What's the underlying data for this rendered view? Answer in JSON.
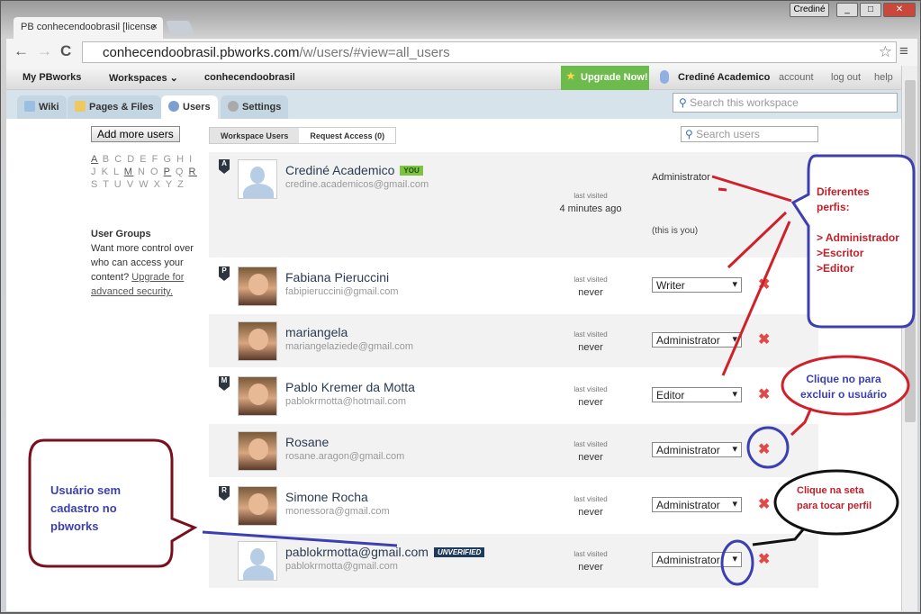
{
  "window": {
    "title_badge": "Crediné",
    "controls": [
      "_",
      "□",
      "✕"
    ]
  },
  "browser": {
    "tab_title": "PB conhecendoobrasil [license",
    "tab_close": "×",
    "url_host": "conhecendoobrasil.pbworks.com",
    "url_path": "/w/users/#view=all_users",
    "back": "←",
    "forward": "→",
    "reload": "C",
    "star": "☆",
    "menu": "≡"
  },
  "topbar": {
    "my_pbworks": "My PBworks",
    "workspaces": "Workspaces ⌄",
    "workspace": "conhecendoobrasil",
    "upgrade": "Upgrade Now!",
    "user": "Crediné Academico",
    "account": "account",
    "logout": "log out",
    "help": "help"
  },
  "tabs": [
    {
      "label": "Wiki"
    },
    {
      "label": "Pages & Files"
    },
    {
      "label": "Users",
      "active": true
    },
    {
      "label": "Settings"
    }
  ],
  "workspace_search_placeholder": "Search this workspace",
  "sidebar": {
    "add_users": "Add more users",
    "alpha_rows": [
      [
        "A",
        "B",
        "C",
        "D",
        "E",
        "F",
        "G",
        "H",
        "I"
      ],
      [
        "J",
        "K",
        "L",
        "M",
        "N",
        "O",
        "P",
        "Q",
        "R"
      ],
      [
        "S",
        "T",
        "U",
        "V",
        "W",
        "X",
        "Y",
        "Z"
      ]
    ],
    "alpha_active": [
      "A",
      "M",
      "P",
      "R"
    ],
    "groups_title": "User Groups",
    "groups_text": "Want more control over who can access your content?",
    "groups_link": "Upgrade for advanced security."
  },
  "segments": {
    "workspace_users": "Workspace Users",
    "request_access": "Request Access (0)"
  },
  "user_search_placeholder": "Search users",
  "users": [
    {
      "marker": "A",
      "name": "Crediné Academico",
      "badge": "YOU",
      "email": "credine.academicos@gmail.com",
      "last_visited_label": "last visited",
      "last_visited": "4 minutes ago",
      "role": "Administrator",
      "note": "(this is you)",
      "photo": false
    },
    {
      "marker": "P",
      "name": "Fabiana Pieruccini",
      "email": "fabipieruccini@gmail.com",
      "last_visited_label": "last visited",
      "last_visited": "never",
      "role": "Writer",
      "photo": true
    },
    {
      "marker": "",
      "name": "mariangela",
      "email": "mariangelaziede@gmail.com",
      "last_visited_label": "last visited",
      "last_visited": "never",
      "role": "Administrator",
      "photo": true
    },
    {
      "marker": "M",
      "name": "Pablo Kremer da Motta",
      "email": "pablokrmotta@hotmail.com",
      "last_visited_label": "last visited",
      "last_visited": "never",
      "role": "Editor",
      "photo": true
    },
    {
      "marker": "",
      "name": "Rosane",
      "email": "rosane.aragon@gmail.com",
      "last_visited_label": "last visited",
      "last_visited": "never",
      "role": "Administrator",
      "photo": true
    },
    {
      "marker": "R",
      "name": "Simone Rocha",
      "email": "monessora@gmail.com",
      "last_visited_label": "last visited",
      "last_visited": "never",
      "role": "Administrator",
      "photo": true
    },
    {
      "marker": "",
      "name": "pablokrmotta@gmail.com",
      "badge": "UNVERIFIED",
      "email": "pablokrmotta@gmail.com",
      "last_visited_label": "last visited",
      "last_visited": "never",
      "role": "Administrator",
      "photo": false
    }
  ],
  "delete_icon": "✖",
  "annotations": {
    "profiles": [
      "Diferentes",
      "perfis:",
      "",
      "> Administrador",
      ">Escritor",
      ">Editor"
    ],
    "delete": [
      "Clique no     para",
      "excluir o usuário"
    ],
    "arrow": [
      "Clique na seta",
      "para tocar perfil"
    ],
    "unregistered": [
      "Usuário sem",
      "cadastro no",
      "pbworks"
    ]
  },
  "colors": {
    "upgrade": "#6dbb4c",
    "delete": "#e24a4a",
    "you_badge": "#7dc242",
    "unverified_badge": "#1f3b5a",
    "ann_red": "#d0202a",
    "ann_blue": "#3b3fb0",
    "ann_maroon": "#7a0f1e"
  }
}
